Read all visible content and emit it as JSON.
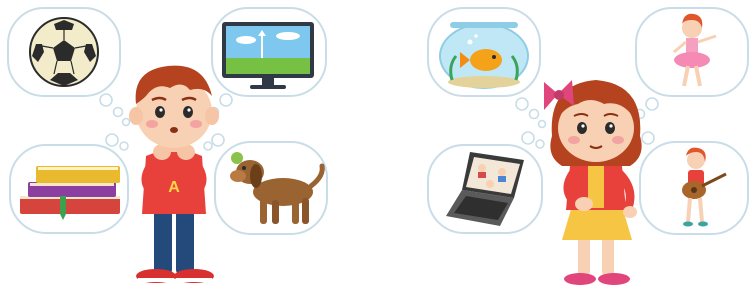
{
  "boy": {
    "shirt_letter": "A",
    "shirt_color": "#e8413c",
    "thoughts": [
      "soccer-ball",
      "television",
      "books",
      "dog"
    ]
  },
  "girl": {
    "dress_color": "#f6c544",
    "bow_color": "#e0457b",
    "thoughts": [
      "goldfish-bowl",
      "ballerina-girl",
      "laptop-video-call",
      "guitar-girl"
    ]
  }
}
